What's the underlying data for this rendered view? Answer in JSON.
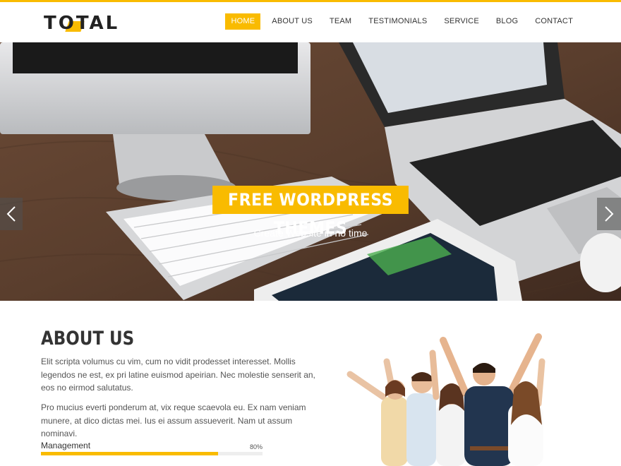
{
  "brand": {
    "logo_text": "TOTAL",
    "accent": "#f9bb00"
  },
  "nav": {
    "items": [
      {
        "label": "HOME",
        "active": true
      },
      {
        "label": "ABOUT US",
        "active": false
      },
      {
        "label": "TEAM",
        "active": false
      },
      {
        "label": "TESTIMONIALS",
        "active": false
      },
      {
        "label": "SERVICE",
        "active": false
      },
      {
        "label": "BLOG",
        "active": false
      },
      {
        "label": "CONTACT",
        "active": false
      }
    ]
  },
  "hero": {
    "title": "FREE WORDPRESS THEMES",
    "subtitle": "Create Website in no time",
    "prev_icon": "chevron-left-icon",
    "next_icon": "chevron-right-icon"
  },
  "about": {
    "title": "ABOUT US",
    "paragraphs": [
      "Elit scripta volumus cu vim, cum no vidit prodesset interesset. Mollis legendos ne est, ex pri latine euismod apeirian. Nec molestie senserit an, eos no eirmod salutatus.",
      "Pro mucius everti ponderum at, vix reque scaevola eu. Ex nam veniam munere, at dico dictas mei. Ius ei assum assueverit. Nam ut assum nominavi."
    ],
    "skill": {
      "label": "Management",
      "percent_text": "80%",
      "percent": 80
    }
  }
}
